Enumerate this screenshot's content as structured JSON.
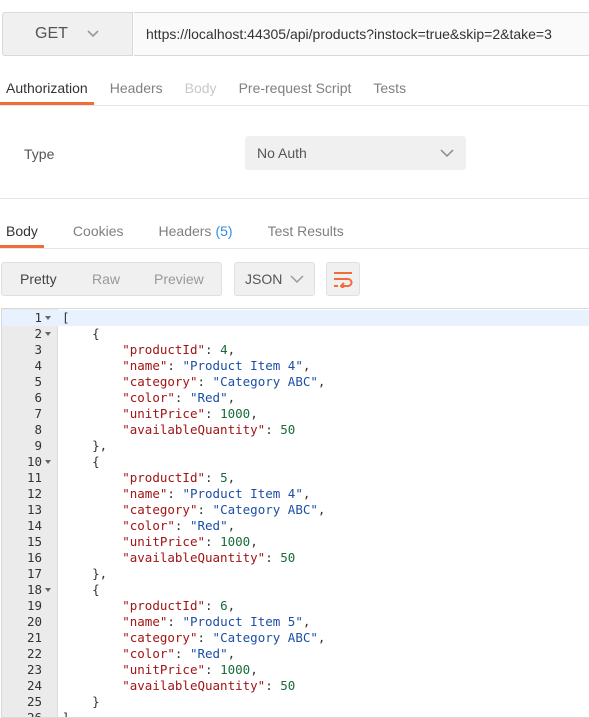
{
  "request": {
    "method": "GET",
    "url": "https://localhost:44305/api/products?instock=true&skip=2&take=3"
  },
  "request_tabs": [
    {
      "label": "Authorization",
      "state": "active"
    },
    {
      "label": "Headers",
      "state": "normal"
    },
    {
      "label": "Body",
      "state": "disabled"
    },
    {
      "label": "Pre-request Script",
      "state": "normal"
    },
    {
      "label": "Tests",
      "state": "normal"
    }
  ],
  "auth": {
    "type_label": "Type",
    "type_value": "No Auth"
  },
  "response_tabs": [
    {
      "label": "Body",
      "count": "",
      "state": "active"
    },
    {
      "label": "Cookies",
      "count": "",
      "state": "normal"
    },
    {
      "label": "Headers",
      "count": "(5)",
      "state": "normal"
    },
    {
      "label": "Test Results",
      "count": "",
      "state": "normal"
    }
  ],
  "view": {
    "modes": [
      "Pretty",
      "Raw",
      "Preview"
    ],
    "selected_mode": "Pretty",
    "format": "JSON"
  },
  "editor": {
    "fold_lines": [
      1,
      2,
      10,
      18
    ],
    "lines": [
      [
        [
          "p",
          "["
        ]
      ],
      [
        [
          "p",
          "    {"
        ]
      ],
      [
        [
          "p",
          "        "
        ],
        [
          "k",
          "\"productId\""
        ],
        [
          "p",
          ": "
        ],
        [
          "n",
          "4"
        ],
        [
          "p",
          ","
        ]
      ],
      [
        [
          "p",
          "        "
        ],
        [
          "k",
          "\"name\""
        ],
        [
          "p",
          ": "
        ],
        [
          "s",
          "\"Product Item 4\""
        ],
        [
          "p",
          ","
        ]
      ],
      [
        [
          "p",
          "        "
        ],
        [
          "k",
          "\"category\""
        ],
        [
          "p",
          ": "
        ],
        [
          "s",
          "\"Category ABC\""
        ],
        [
          "p",
          ","
        ]
      ],
      [
        [
          "p",
          "        "
        ],
        [
          "k",
          "\"color\""
        ],
        [
          "p",
          ": "
        ],
        [
          "s",
          "\"Red\""
        ],
        [
          "p",
          ","
        ]
      ],
      [
        [
          "p",
          "        "
        ],
        [
          "k",
          "\"unitPrice\""
        ],
        [
          "p",
          ": "
        ],
        [
          "n",
          "1000"
        ],
        [
          "p",
          ","
        ]
      ],
      [
        [
          "p",
          "        "
        ],
        [
          "k",
          "\"availableQuantity\""
        ],
        [
          "p",
          ": "
        ],
        [
          "n",
          "50"
        ]
      ],
      [
        [
          "p",
          "    },"
        ]
      ],
      [
        [
          "p",
          "    {"
        ]
      ],
      [
        [
          "p",
          "        "
        ],
        [
          "k",
          "\"productId\""
        ],
        [
          "p",
          ": "
        ],
        [
          "n",
          "5"
        ],
        [
          "p",
          ","
        ]
      ],
      [
        [
          "p",
          "        "
        ],
        [
          "k",
          "\"name\""
        ],
        [
          "p",
          ": "
        ],
        [
          "s",
          "\"Product Item 4\""
        ],
        [
          "p",
          ","
        ]
      ],
      [
        [
          "p",
          "        "
        ],
        [
          "k",
          "\"category\""
        ],
        [
          "p",
          ": "
        ],
        [
          "s",
          "\"Category ABC\""
        ],
        [
          "p",
          ","
        ]
      ],
      [
        [
          "p",
          "        "
        ],
        [
          "k",
          "\"color\""
        ],
        [
          "p",
          ": "
        ],
        [
          "s",
          "\"Red\""
        ],
        [
          "p",
          ","
        ]
      ],
      [
        [
          "p",
          "        "
        ],
        [
          "k",
          "\"unitPrice\""
        ],
        [
          "p",
          ": "
        ],
        [
          "n",
          "1000"
        ],
        [
          "p",
          ","
        ]
      ],
      [
        [
          "p",
          "        "
        ],
        [
          "k",
          "\"availableQuantity\""
        ],
        [
          "p",
          ": "
        ],
        [
          "n",
          "50"
        ]
      ],
      [
        [
          "p",
          "    },"
        ]
      ],
      [
        [
          "p",
          "    {"
        ]
      ],
      [
        [
          "p",
          "        "
        ],
        [
          "k",
          "\"productId\""
        ],
        [
          "p",
          ": "
        ],
        [
          "n",
          "6"
        ],
        [
          "p",
          ","
        ]
      ],
      [
        [
          "p",
          "        "
        ],
        [
          "k",
          "\"name\""
        ],
        [
          "p",
          ": "
        ],
        [
          "s",
          "\"Product Item 5\""
        ],
        [
          "p",
          ","
        ]
      ],
      [
        [
          "p",
          "        "
        ],
        [
          "k",
          "\"category\""
        ],
        [
          "p",
          ": "
        ],
        [
          "s",
          "\"Category ABC\""
        ],
        [
          "p",
          ","
        ]
      ],
      [
        [
          "p",
          "        "
        ],
        [
          "k",
          "\"color\""
        ],
        [
          "p",
          ": "
        ],
        [
          "s",
          "\"Red\""
        ],
        [
          "p",
          ","
        ]
      ],
      [
        [
          "p",
          "        "
        ],
        [
          "k",
          "\"unitPrice\""
        ],
        [
          "p",
          ": "
        ],
        [
          "n",
          "1000"
        ],
        [
          "p",
          ","
        ]
      ],
      [
        [
          "p",
          "        "
        ],
        [
          "k",
          "\"availableQuantity\""
        ],
        [
          "p",
          ": "
        ],
        [
          "n",
          "50"
        ]
      ],
      [
        [
          "p",
          "    }"
        ]
      ],
      [
        [
          "p",
          "]"
        ]
      ]
    ]
  },
  "colors": {
    "accent": "#f26b3a",
    "link": "#2f8fde",
    "key": "#a31515",
    "string": "#1c4fa5",
    "number": "#1a6b3a"
  },
  "icons": {
    "method_dropdown": "chevron-down-icon",
    "auth_dropdown": "chevron-down-icon",
    "format_dropdown": "chevron-down-icon",
    "wrap": "wrap-lines-icon",
    "fold": "fold-arrow-icon"
  }
}
